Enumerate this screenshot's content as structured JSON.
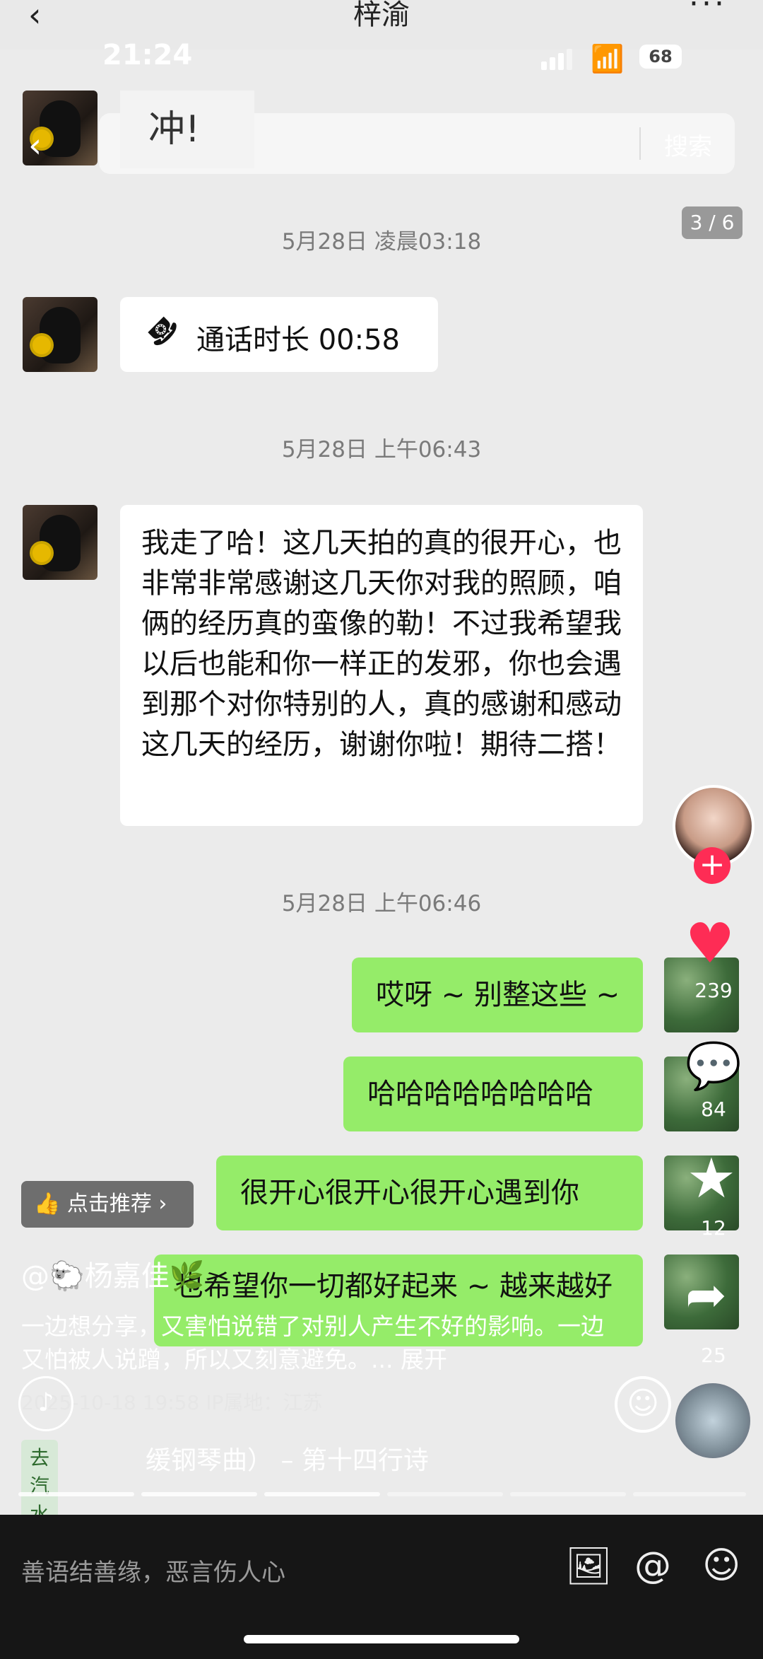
{
  "topbar": {
    "back": "‹",
    "title": "梓渝",
    "more": "···"
  },
  "status": {
    "time": "21:24",
    "battery": "68"
  },
  "search": {
    "value": "冲!",
    "button": "搜索",
    "back": "‹"
  },
  "pager": "3 / 6",
  "chat": {
    "ts1": "5月28日 凌晨03:18",
    "call_icon": "☎",
    "call": "通话时长 00:58",
    "ts2": "5月28日 上午06:43",
    "long_msg": "我走了哈！这几天拍的真的很开心，也非常非常感谢这几天你对我的照顾，咱俩的经历真的蛮像的勒！不过我希望我以后也能和你一样正的发邪，你也会遇到那个对你特别的人，真的感谢和感动这几天的经历，谢谢你啦！期待二搭！",
    "ts3": "5月28日 上午06:46",
    "reply1": "哎呀 ~ 别整这些 ~",
    "reply2": "哈哈哈哈哈哈哈哈",
    "reply3": "很开心很开心很开心遇到你",
    "reply4": "也希望你一切都好起来 ~ 越来越好"
  },
  "side": {
    "plus": "+",
    "likes": "239",
    "comments": "84",
    "favorites": "12",
    "shares": "25",
    "heart": "♥",
    "comment_glyph": "💬",
    "star": "★",
    "share": "➦",
    "emoji": "☺"
  },
  "post": {
    "recommend": "👍 点击推荐  ›",
    "author": "@🐑杨嘉佳🌿",
    "desc": "一边想分享，又害怕说错了对别人产生不好的影响。一边又怕被人说蹭，所以又刻意避免。...",
    "expand": "展开",
    "meta": "2025-10-18 19:58  IP属地：江苏",
    "music_tag": "去汽水听 ›",
    "song": "缓钢琴曲）  –  第十四行诗",
    "sound": "♪"
  },
  "bottom": {
    "placeholder": "善语结善缘，恶言伤人心",
    "img": "🖼",
    "at": "@",
    "smile": "☺"
  },
  "colors": {
    "green_bubble": "#95ec69",
    "red": "#fe2c55",
    "dark": "#161616"
  }
}
